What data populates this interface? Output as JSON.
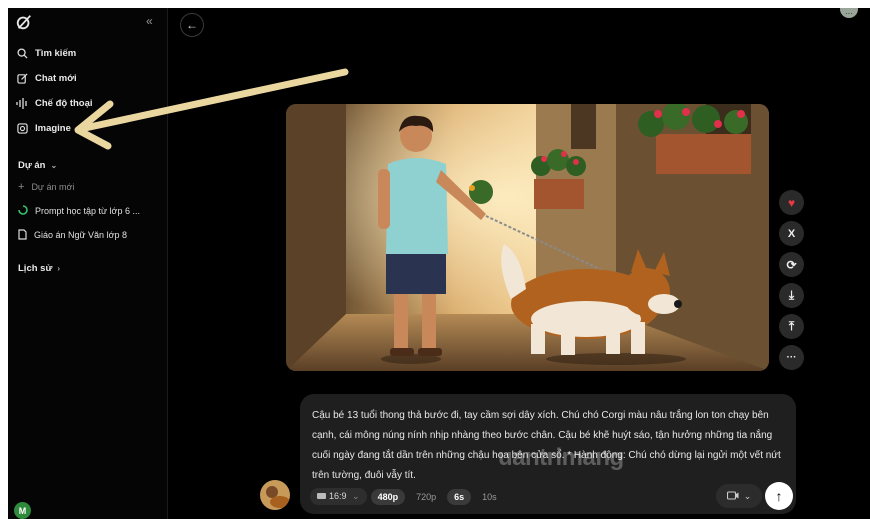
{
  "sidebar": {
    "collapse_label": "«",
    "nav": [
      {
        "label": "Tìm kiếm",
        "icon": "search-icon"
      },
      {
        "label": "Chat mới",
        "icon": "edit-icon"
      },
      {
        "label": "Chế độ thoại",
        "icon": "voice-wave-icon"
      },
      {
        "label": "Imagine",
        "icon": "image-icon"
      }
    ],
    "projects_title": "Dự án",
    "projects_chevron": "⌄",
    "projects": [
      {
        "label": "Dự án mới",
        "icon": "plus-icon"
      },
      {
        "label": "Prompt học tập từ lớp 6 ...",
        "icon": "progress-icon"
      },
      {
        "label": "Giáo án Ngữ Văn lớp 8",
        "icon": "document-icon"
      }
    ],
    "history_title": "Lịch sử",
    "history_chevron": "›",
    "avatar_initial": "M"
  },
  "main": {
    "back_label": "←",
    "top_menu_label": "···",
    "actions": [
      {
        "name": "like-button",
        "icon": "heart-icon",
        "glyph": "♥"
      },
      {
        "name": "share-x-button",
        "icon": "x-logo-icon",
        "glyph": "𝕏"
      },
      {
        "name": "regenerate-button",
        "icon": "refresh-icon",
        "glyph": "⟳"
      },
      {
        "name": "download-button",
        "icon": "download-icon",
        "glyph": "⤓"
      },
      {
        "name": "upload-button",
        "icon": "upload-icon",
        "glyph": "⤒"
      },
      {
        "name": "more-button",
        "icon": "more-icon",
        "glyph": "···"
      }
    ],
    "prompt": "Cậu bé 13 tuổi thong thả bước đi, tay cầm sợi dây xích. Chú chó Corgi màu nâu trắng lon ton chạy bên cạnh, cái mông núng nính nhịp nhàng theo bước chân. Cậu bé khẽ huýt sáo, tận hưởng những tia nắng cuối ngày đang tắt dần trên những chậu hoa bên cửa sổ. * Hành động: Chú chó dừng lại ngửi một vết nứt trên tường, đuôi vẫy tít.",
    "options": {
      "aspect": "16:9",
      "aspect_chevron": "⌄",
      "res_selected": "480p",
      "res_other": "720p",
      "dur_selected": "6s",
      "dur_other": "10s"
    },
    "video_chevron": "⌄",
    "send_label": "↑",
    "watermark": "uantrimang"
  },
  "colors": {
    "background": "#000000",
    "sidebar": "#050505",
    "prompt_box": "#1f1f1f",
    "annotation_arrow": "#ead7a0",
    "heart": "#e63946"
  }
}
